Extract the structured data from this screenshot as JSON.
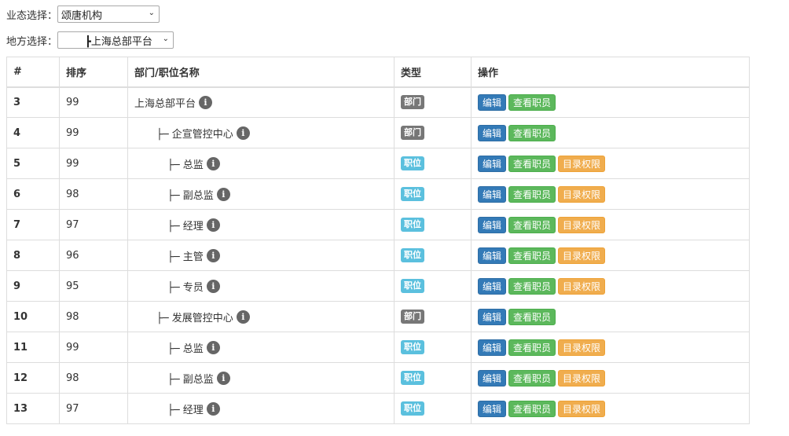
{
  "filters": {
    "business_label": "业态选择：",
    "business_value": "颂唐机构",
    "region_label": "地方选择：",
    "region_value": "┣上海总部平台"
  },
  "table": {
    "headers": [
      "#",
      "排序",
      "部门/职位名称",
      "类型",
      "操作"
    ],
    "rows": [
      {
        "id": "3",
        "sort": "99",
        "name": "上海总部平台",
        "type": "部门"
      },
      {
        "id": "4",
        "sort": "99",
        "name": "├─ 企宣管控中心",
        "type": "部门"
      },
      {
        "id": "5",
        "sort": "99",
        "name": "├─ 总监",
        "type": "职位"
      },
      {
        "id": "6",
        "sort": "98",
        "name": "├─ 副总监",
        "type": "职位"
      },
      {
        "id": "7",
        "sort": "97",
        "name": "├─ 经理",
        "type": "职位"
      },
      {
        "id": "8",
        "sort": "96",
        "name": "├─ 主管",
        "type": "职位"
      },
      {
        "id": "9",
        "sort": "95",
        "name": "├─ 专员",
        "type": "职位"
      },
      {
        "id": "10",
        "sort": "98",
        "name": "├─ 发展管控中心",
        "type": "部门"
      },
      {
        "id": "11",
        "sort": "99",
        "name": "├─ 总监",
        "type": "职位"
      },
      {
        "id": "12",
        "sort": "98",
        "name": "├─ 副总监",
        "type": "职位"
      },
      {
        "id": "13",
        "sort": "97",
        "name": "├─ 经理",
        "type": "职位"
      }
    ]
  },
  "actions": {
    "edit": "编辑",
    "view_staff": "查看职员",
    "dir_permission": "目录权限"
  },
  "icons": {
    "info": "i"
  },
  "colors": {
    "edit_btn": "#337ab7",
    "view_btn": "#5cb85c",
    "perm_btn": "#f0ad4e",
    "dept_badge": "#777777",
    "pos_badge": "#5bc0de"
  }
}
